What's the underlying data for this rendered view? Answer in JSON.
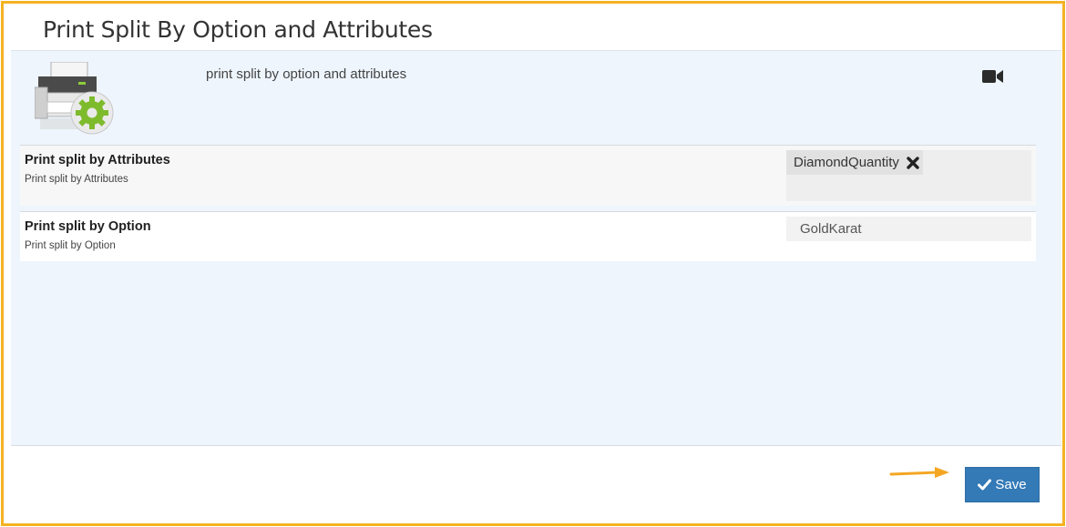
{
  "page": {
    "title": "Print Split By Option and Attributes",
    "description": "print split by option and attributes",
    "icons": {
      "header": "printer-settings-icon",
      "video": "video-camera-icon"
    }
  },
  "settings": [
    {
      "title": "Print split by Attributes",
      "subtitle": "Print split by Attributes",
      "control": "tag-input",
      "tags": [
        {
          "label": "DiamondQuantity",
          "remove_icon": "close-x-icon"
        }
      ]
    },
    {
      "title": "Print split by Option",
      "subtitle": "Print split by Option",
      "control": "select",
      "selected": "GoldKarat"
    }
  ],
  "footer": {
    "save_label": "Save",
    "save_icon": "checkmark-icon",
    "pointer_icon": "arrow-right-icon"
  },
  "colors": {
    "frame_highlight": "#f4b223",
    "panel_bg": "#eef5fd",
    "primary_button": "#337ab7",
    "gear_green": "#7dbb2c"
  }
}
